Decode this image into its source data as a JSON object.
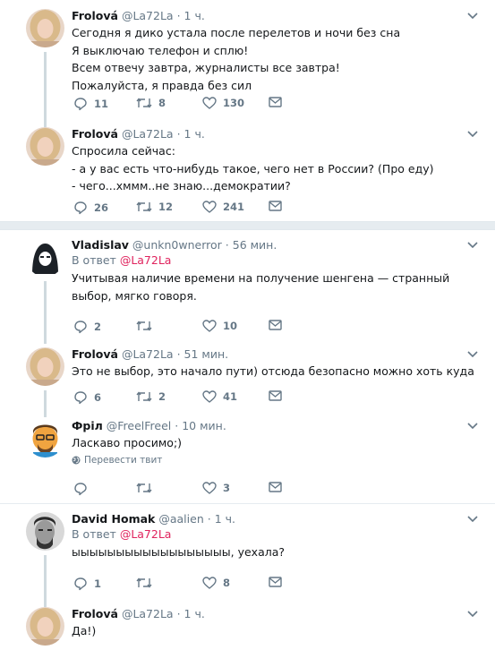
{
  "tweets": [
    {
      "name": "Frolová",
      "handle": "@La72La",
      "time": "1 ч.",
      "avatar": "blonde-woman-avatar",
      "text": "Сегодня я дико устала после перелетов и ночи без сна\nЯ выключаю телефон и сплю!\nВсем отвечу завтра, журналисты все завтра!\nПожалуйста, я правда без сил",
      "replies": "11",
      "retweets": "8",
      "likes": "130"
    },
    {
      "name": "Frolová",
      "handle": "@La72La",
      "time": "1 ч.",
      "avatar": "blonde-woman-avatar",
      "text": "Спросила сейчас:\n- а у вас есть что-нибудь такое, чего нет в России? (Про еду)\n- чего...хммм..не знаю...демократии?",
      "replies": "26",
      "retweets": "12",
      "likes": "241"
    },
    {
      "name": "Vladislav",
      "handle": "@unkn0wnerror",
      "time": "56 мин.",
      "avatar": "hooded-figure-avatar",
      "reply_prefix": "В ответ",
      "reply_to": "@La72La",
      "text": "Учитывая наличие времени на получение шенгена — странный выбор, мягко говоря.",
      "replies": "2",
      "retweets": "",
      "likes": "10"
    },
    {
      "name": "Frolová",
      "handle": "@La72La",
      "time": "51 мин.",
      "avatar": "blonde-woman-avatar",
      "text": "Это не выбор, это начало пути) отсюда безопасно можно хоть куда",
      "replies": "6",
      "retweets": "2",
      "likes": "41"
    },
    {
      "name": "Фріл",
      "handle": "@FreelFreel",
      "time": "10 мин.",
      "avatar": "cartoon-man-avatar",
      "text": "Ласкаво просимо;)",
      "translate": "Перевести твит",
      "replies": "",
      "retweets": "",
      "likes": "3"
    },
    {
      "name": "David Homak",
      "handle": "@aalien",
      "time": "1 ч.",
      "avatar": "bw-man-avatar",
      "reply_prefix": "В ответ",
      "reply_to": "@La72La",
      "text": "ыыыыыыыыыыыыыыыыыы, уехала?",
      "replies": "1",
      "retweets": "",
      "likes": "8"
    },
    {
      "name": "Frolová",
      "handle": "@La72La",
      "time": "1 ч.",
      "avatar": "blonde-woman-avatar",
      "text": "Да!)"
    }
  ],
  "colors": {
    "mention": "#e0245e",
    "muted": "#657786",
    "thread_line": "#cfd9de",
    "separator": "#e6ecf0"
  }
}
